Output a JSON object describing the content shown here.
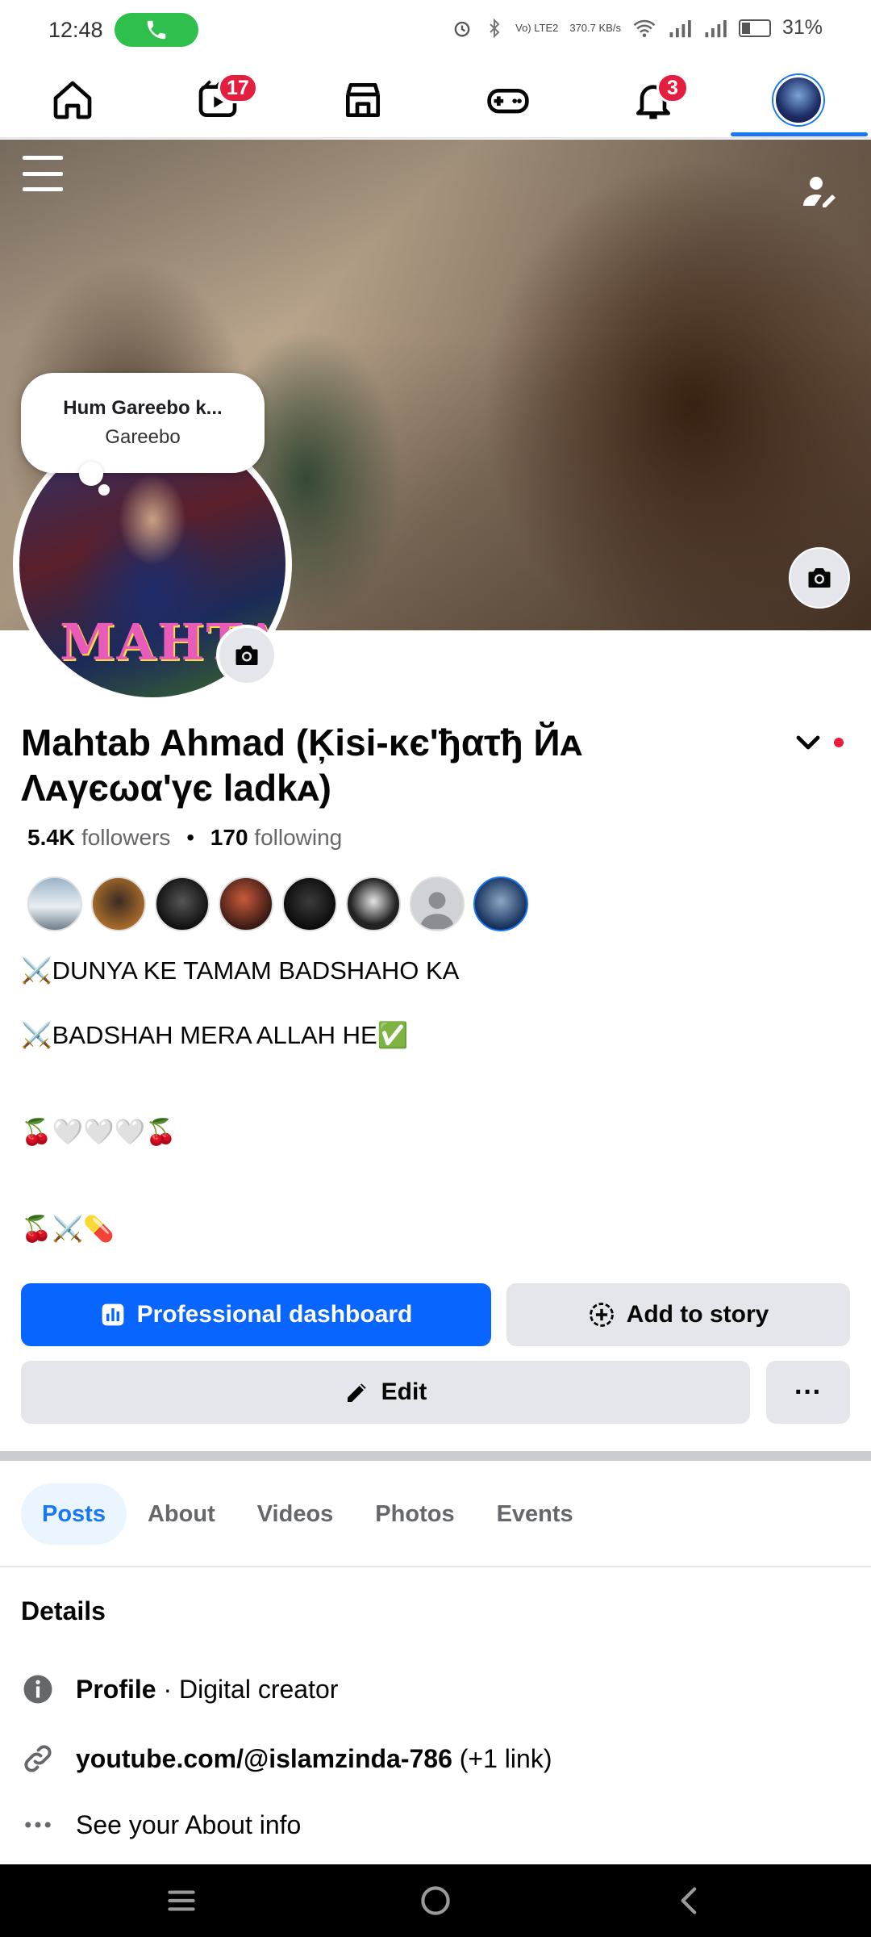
{
  "status_bar": {
    "time": "12:48",
    "net_label": "Vo) LTE2",
    "net_speed": "370.7 KB/s",
    "battery": "31%",
    "icons": [
      "call-icon",
      "alarm-icon",
      "bluetooth-icon",
      "wifi-icon",
      "signal-icon",
      "battery-icon"
    ]
  },
  "nav": {
    "items": [
      {
        "name": "home-icon",
        "badge": ""
      },
      {
        "name": "video-icon",
        "badge": "17"
      },
      {
        "name": "marketplace-icon",
        "badge": ""
      },
      {
        "name": "gaming-icon",
        "badge": ""
      },
      {
        "name": "notifications-icon",
        "badge": "3"
      },
      {
        "name": "profile-avatar-icon",
        "badge": ""
      }
    ],
    "accent": "#1877f2",
    "badge_color": "#e41e3f"
  },
  "note": {
    "title": "Hum Gareebo k...",
    "subtitle": "Gareebo"
  },
  "avatar_text": "MAHTAB",
  "profile": {
    "name": "Mahtab Ahmad (Ķisi-κє'ђατђ Йᴀ Λᴀγєωα'γє ladkᴀ)",
    "followers_count": "5.4K",
    "followers_label": "followers",
    "separator": "•",
    "following_count": "170",
    "following_label": "following"
  },
  "bio": {
    "line1": "⚔️DUNYA KE TAMAM BADSHAHO KA",
    "line2": "⚔️BADSHAH MERA ALLAH HE✅",
    "line3": "🍒🤍🤍🤍🍒",
    "line4": "🍒⚔️💊"
  },
  "buttons": {
    "professional_dashboard": "Professional dashboard",
    "add_to_story": "Add to story",
    "edit": "Edit",
    "more": "···"
  },
  "tabs": [
    {
      "label": "Posts",
      "active": true
    },
    {
      "label": "About",
      "active": false
    },
    {
      "label": "Videos",
      "active": false
    },
    {
      "label": "Photos",
      "active": false
    },
    {
      "label": "Events",
      "active": false
    }
  ],
  "details": {
    "title": "Details",
    "profile_label": "Profile",
    "profile_value": " · Digital creator",
    "link": "youtube.com/@islamzinda-786",
    "link_extra": " (+1 link)",
    "about_info": "See your About info"
  }
}
